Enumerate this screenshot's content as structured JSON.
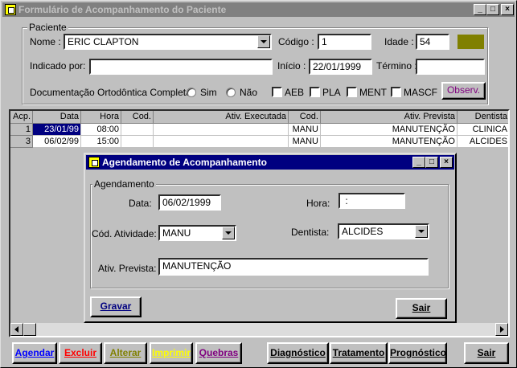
{
  "main_window": {
    "title": "Formulário de Acompanhamento do Paciente"
  },
  "paciente": {
    "group_label": "Paciente",
    "nome_label": "Nome :",
    "nome_value": "ERIC CLAPTON",
    "codigo_label": "Código :",
    "codigo_value": "1",
    "idade_label": "Idade :",
    "idade_value": "54",
    "color_swatch": "#808000",
    "indicado_label": "Indicado por:",
    "indicado_value": "",
    "inicio_label": "Início :",
    "inicio_value": "22/01/1999",
    "termino_label": "Término :",
    "termino_value": "",
    "doc_label": "Documentação Ortodôntica Completa:",
    "sim_label": "Sim",
    "nao_label": "Não",
    "aeb_label": "AEB",
    "pla_label": "PLA",
    "ment_label": "MENT",
    "mascf_label": "MASCF",
    "observ_label": "Observ."
  },
  "grid": {
    "headers": [
      "Acp.",
      "Data",
      "Hora",
      "Cod.",
      "Ativ. Executada",
      "Cod.",
      "Ativ. Prevista",
      "Dentista"
    ],
    "rows": [
      [
        "1",
        "23/01/99",
        "08:00",
        "",
        "",
        "MANU",
        "MANUTENÇÃO",
        "CLINICA"
      ],
      [
        "3",
        "06/02/99",
        "15:00",
        "",
        "",
        "MANU",
        "MANUTENÇÃO",
        "ALCIDES"
      ]
    ]
  },
  "dialog": {
    "title": "Agendamento de Acompanhamento",
    "group_label": "Agendamento",
    "data_label": "Data:",
    "data_value": "06/02/1999",
    "hora_label": "Hora:",
    "hora_value": " :",
    "cod_label": "Cód. Atividade:",
    "cod_value": "MANU",
    "dentista_label": "Dentista:",
    "dentista_value": "ALCIDES",
    "ativ_label": "Ativ. Prevista:",
    "ativ_value": "MANUTENÇÃO",
    "gravar_label": "Gravar",
    "sair_label": "Sair"
  },
  "toolbar": {
    "agendar": "Agendar",
    "excluir": "Excluir",
    "alterar": "Alterar",
    "imprimir": "Imprimir",
    "quebras": "Quebras",
    "diagnostico": "Diagnóstico",
    "tratamento": "Tratamento",
    "prognostico": "Prognóstico",
    "sair": "Sair",
    "colors": {
      "agendar": "#0000ff",
      "excluir": "#ff0000",
      "alterar": "#808000",
      "imprimir": "#ffff00",
      "quebras": "#800080"
    }
  }
}
